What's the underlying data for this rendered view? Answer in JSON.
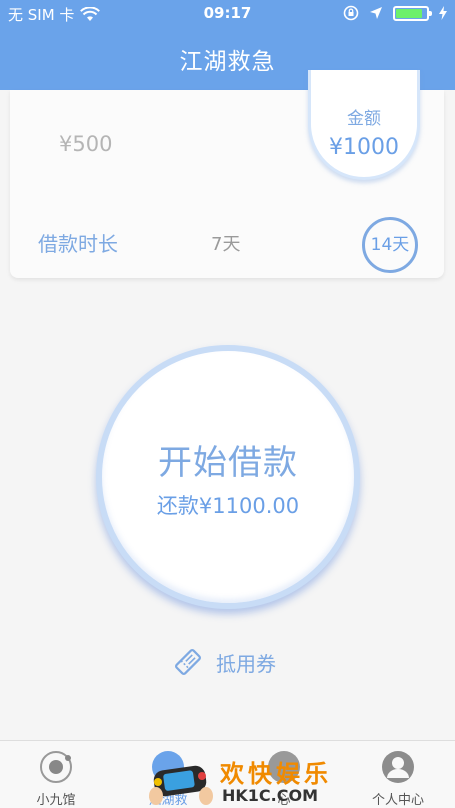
{
  "status_bar": {
    "carrier": "无 SIM 卡",
    "time": "09:17"
  },
  "nav": {
    "title": "江湖救急"
  },
  "loan_card": {
    "amount_option_left": "¥500",
    "amount_label": "金额",
    "amount_selected": "¥1000",
    "duration_label": "借款时长",
    "duration_option_7": "7天",
    "duration_option_14": "14天"
  },
  "main": {
    "start_button": "开始借款",
    "repay_text": "还款¥1100.00",
    "coupon_label": "抵用券"
  },
  "tabbar": {
    "items": [
      {
        "label": "小九馆"
      },
      {
        "label": "江湖救"
      },
      {
        "label": "心"
      },
      {
        "label": "个人中心"
      }
    ]
  },
  "watermark": {
    "title": "欢快娱乐",
    "url": "HK1C.COM"
  },
  "colors": {
    "primary": "#6aa3ea",
    "accent_text": "#7ea9e2",
    "battery": "#6df06b",
    "watermark": "#f08a00"
  }
}
